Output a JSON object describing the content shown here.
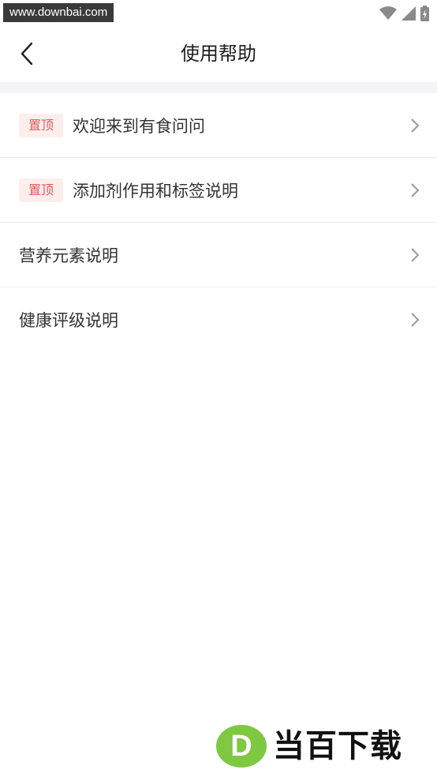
{
  "status_bar": {
    "watermark": "www.downbai.com",
    "icons": [
      "wifi-icon",
      "signal-icon",
      "battery-charging-icon"
    ]
  },
  "header": {
    "back_icon": "chevron-left-icon",
    "title": "使用帮助"
  },
  "help_items": [
    {
      "pinned": true,
      "badge": "置顶",
      "label": "欢迎来到有食问问"
    },
    {
      "pinned": true,
      "badge": "置顶",
      "label": "添加剂作用和标签说明"
    },
    {
      "pinned": false,
      "badge": "",
      "label": "营养元素说明"
    },
    {
      "pinned": false,
      "badge": "",
      "label": "健康评级说明"
    }
  ],
  "watermark_logo": {
    "letter": "D",
    "text": "当百下载"
  },
  "colors": {
    "badge_bg": "#fdeeee",
    "badge_text": "#e45a5a",
    "logo_green": "#7ec842",
    "divider": "#f4f4f6"
  }
}
